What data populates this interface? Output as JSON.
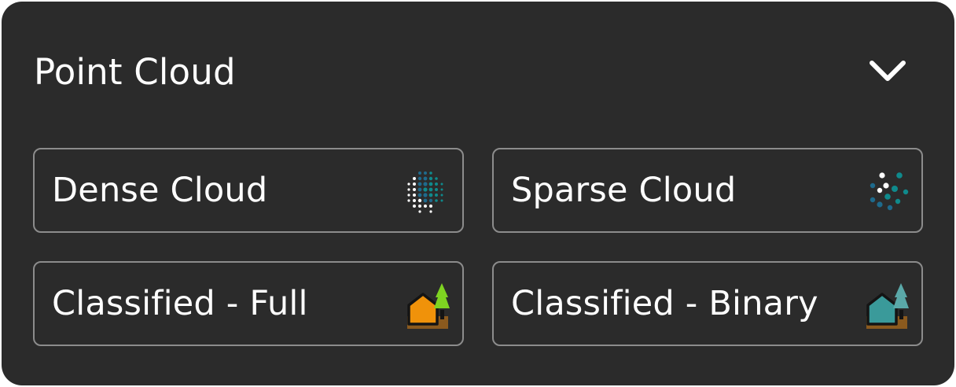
{
  "panel": {
    "title": "Point Cloud",
    "collapse_icon": "chevron-down-icon"
  },
  "options": [
    {
      "label": "Dense Cloud",
      "icon": "dense-cloud-icon"
    },
    {
      "label": "Sparse Cloud",
      "icon": "sparse-cloud-icon"
    },
    {
      "label": "Classified - Full",
      "icon": "classified-full-icon"
    },
    {
      "label": "Classified - Binary",
      "icon": "classified-binary-icon"
    }
  ],
  "colors": {
    "panel_background": "#2b2b2b",
    "option_border": "#8c8c8c",
    "text": "#ffffff",
    "cloud_teal": "#0f8a8c",
    "cloud_blue": "#1e6a8c",
    "classified_orange": "#f0920a",
    "classified_teal": "#3a9a9a",
    "tree_green": "#7ed321",
    "tree_teal": "#5aa8a8",
    "ground_brown": "#8b5a1e"
  }
}
